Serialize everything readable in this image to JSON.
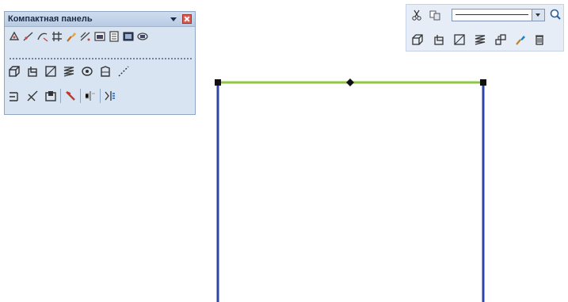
{
  "panel": {
    "title": "Компактная панель",
    "row1_icons": [
      "select-icon",
      "point-icon",
      "curve-icon",
      "hatch-icon",
      "brush-icon",
      "dimension-icon",
      "view-icon",
      "page-icon",
      "sheet-icon",
      "frame-icon"
    ],
    "row2_icons": [
      "extrude-icon",
      "cut-icon",
      "rectangle-icon",
      "spring-icon",
      "rotate-icon",
      "loft-icon",
      "line-icon"
    ],
    "row3_icons": [
      "fillet-icon",
      "trim-icon",
      "shell-icon",
      "delete-icon",
      "mirror-icon",
      "pattern-icon"
    ]
  },
  "toolbar": {
    "row1_icons": [
      "cut-tool-icon",
      "copy-icon",
      "line-style-select",
      "zoom-icon"
    ],
    "row2_icons": [
      "extrude-icon",
      "cut-icon",
      "rectangle-icon",
      "spring-icon",
      "array-icon",
      "brush-icon",
      "delete-icon"
    ]
  },
  "colors": {
    "sketch_line": "#2c47a6",
    "selected_line": "#8ec63f",
    "handle": "#111111"
  }
}
